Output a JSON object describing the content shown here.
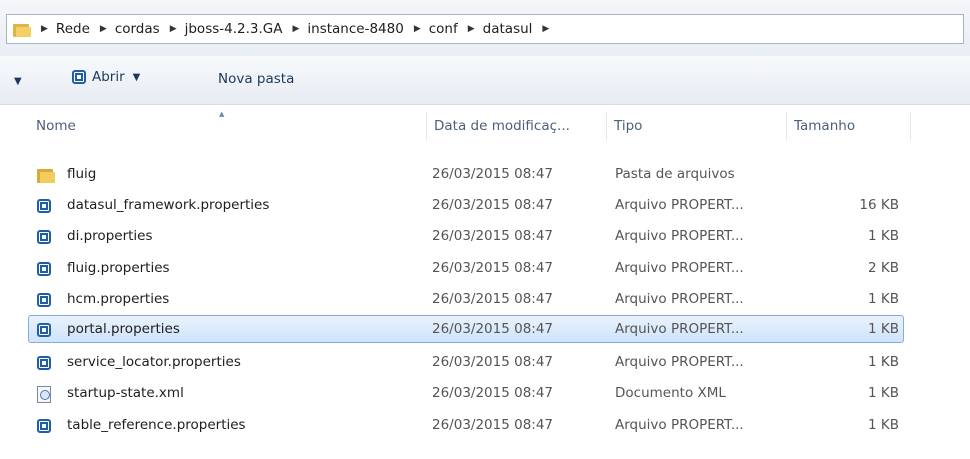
{
  "address": {
    "crumbs": [
      "Rede",
      "cordas",
      "jboss-4.2.3.GA",
      "instance-8480",
      "conf",
      "datasul"
    ]
  },
  "toolbar": {
    "open_label": "Abrir",
    "new_folder_label": "Nova pasta"
  },
  "columns": {
    "name": "Nome",
    "date": "Data de modificaç...",
    "type": "Tipo",
    "size": "Tamanho"
  },
  "files": [
    {
      "icon": "folder-icon",
      "name": "fluig",
      "date": "26/03/2015 08:47",
      "type": "Pasta de arquivos",
      "size": ""
    },
    {
      "icon": "properties-file-icon",
      "name": "datasul_framework.properties",
      "date": "26/03/2015 08:47",
      "type": "Arquivo PROPERT...",
      "size": "16 KB"
    },
    {
      "icon": "properties-file-icon",
      "name": "di.properties",
      "date": "26/03/2015 08:47",
      "type": "Arquivo PROPERT...",
      "size": "1 KB"
    },
    {
      "icon": "properties-file-icon",
      "name": "fluig.properties",
      "date": "26/03/2015 08:47",
      "type": "Arquivo PROPERT...",
      "size": "2 KB"
    },
    {
      "icon": "properties-file-icon",
      "name": "hcm.properties",
      "date": "26/03/2015 08:47",
      "type": "Arquivo PROPERT...",
      "size": "1 KB"
    },
    {
      "icon": "properties-file-icon",
      "name": "portal.properties",
      "date": "26/03/2015 08:47",
      "type": "Arquivo PROPERT...",
      "size": "1 KB"
    },
    {
      "icon": "properties-file-icon",
      "name": "service_locator.properties",
      "date": "26/03/2015 08:47",
      "type": "Arquivo PROPERT...",
      "size": "1 KB"
    },
    {
      "icon": "xml-file-icon",
      "name": "startup-state.xml",
      "date": "26/03/2015 08:47",
      "type": "Documento XML",
      "size": "1 KB"
    },
    {
      "icon": "properties-file-icon",
      "name": "table_reference.properties",
      "date": "26/03/2015 08:47",
      "type": "Arquivo PROPERT...",
      "size": "1 KB"
    }
  ],
  "selected_file": "portal.properties",
  "colors": {
    "selection_bg": "#cfe3fa",
    "selection_border": "#84acdd",
    "header_text": "#4c607a",
    "toolbar_text": "#1e395b"
  }
}
